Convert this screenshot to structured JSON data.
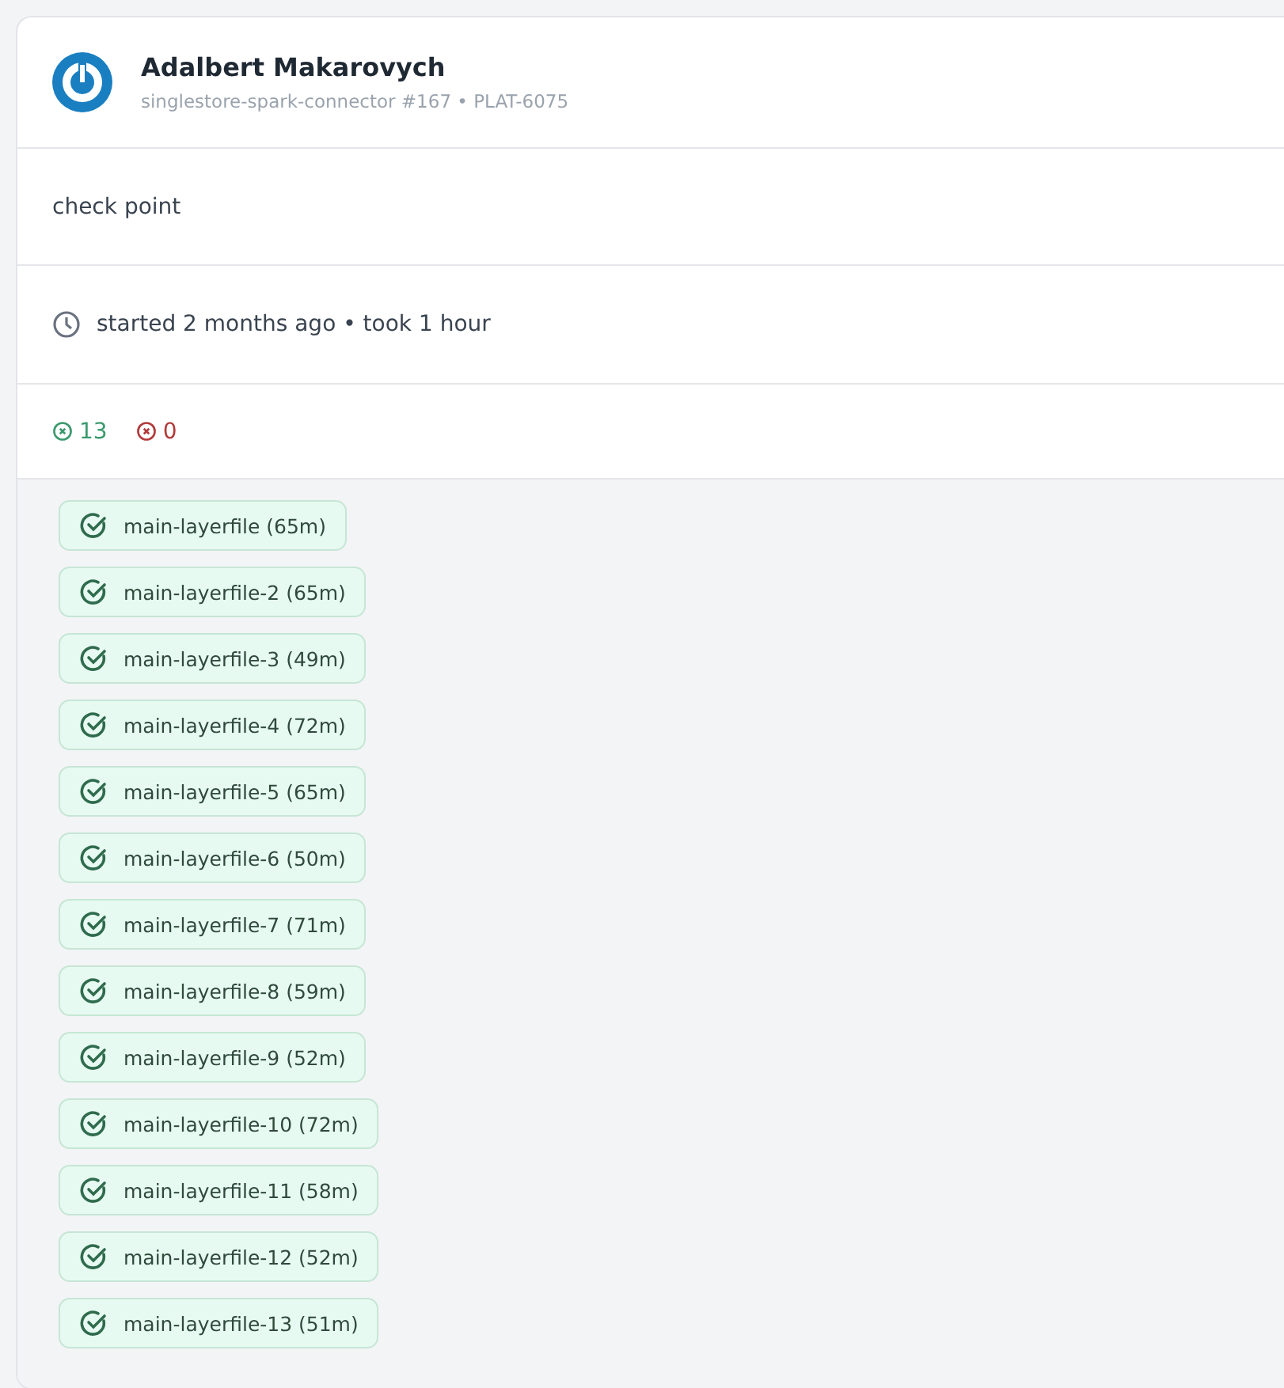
{
  "build": {
    "author": "Adalbert Makarovych",
    "subtitle": "singlestore-spark-connector #167 • PLAT-6075",
    "message": "check point",
    "timing": "started 2 months ago • took 1 hour"
  },
  "counts": [
    {
      "kind": "passed",
      "value": "13"
    },
    {
      "kind": "failed",
      "value": "0"
    }
  ],
  "jobs": [
    {
      "label": "main-layerfile (65m)",
      "kind": "passed"
    },
    {
      "label": "main-layerfile-2 (65m)",
      "kind": "passed"
    },
    {
      "label": "main-layerfile-3 (49m)",
      "kind": "passed"
    },
    {
      "label": "main-layerfile-4 (72m)",
      "kind": "passed"
    },
    {
      "label": "main-layerfile-5 (65m)",
      "kind": "passed"
    },
    {
      "label": "main-layerfile-6 (50m)",
      "kind": "passed"
    },
    {
      "label": "main-layerfile-7 (71m)",
      "kind": "passed"
    },
    {
      "label": "main-layerfile-8 (59m)",
      "kind": "passed"
    },
    {
      "label": "main-layerfile-9 (52m)",
      "kind": "passed"
    },
    {
      "label": "main-layerfile-10 (72m)",
      "kind": "passed"
    },
    {
      "label": "main-layerfile-11 (58m)",
      "kind": "passed"
    },
    {
      "label": "main-layerfile-12 (52m)",
      "kind": "passed"
    },
    {
      "label": "main-layerfile-13 (51m)",
      "kind": "passed"
    }
  ]
}
